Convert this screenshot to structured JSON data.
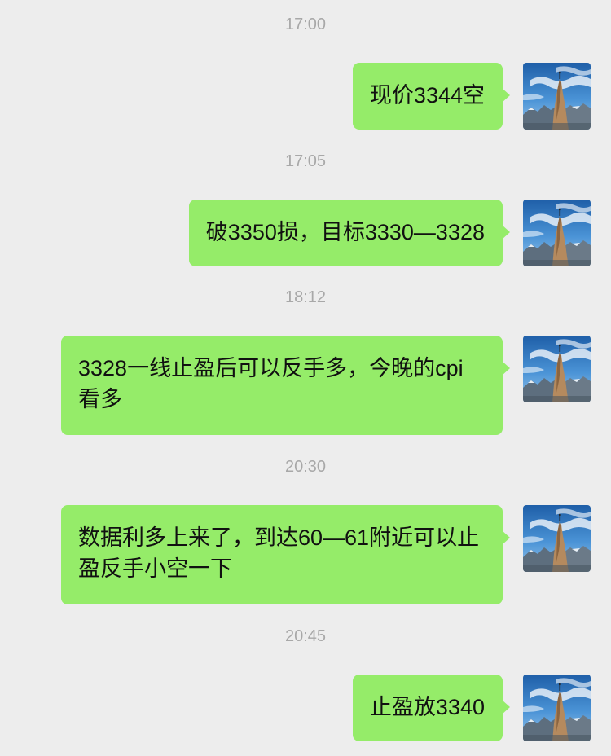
{
  "colors": {
    "background": "#ededed",
    "bubble": "#95ec69",
    "timestamp": "#a8a8a8",
    "text": "#111111"
  },
  "avatar_icon": "mountain-climber-avatar",
  "messages": [
    {
      "time": "17:00",
      "text": "现价3344空"
    },
    {
      "time": "17:05",
      "text": "破3350损，目标3330—3328"
    },
    {
      "time": "18:12",
      "text": "3328一线止盈后可以反手多，今晚的cpi看多"
    },
    {
      "time": "20:30",
      "text": "数据利多上来了，到达60—61附近可以止盈反手小空一下"
    },
    {
      "time": "20:45",
      "text": "止盈放3340"
    }
  ]
}
